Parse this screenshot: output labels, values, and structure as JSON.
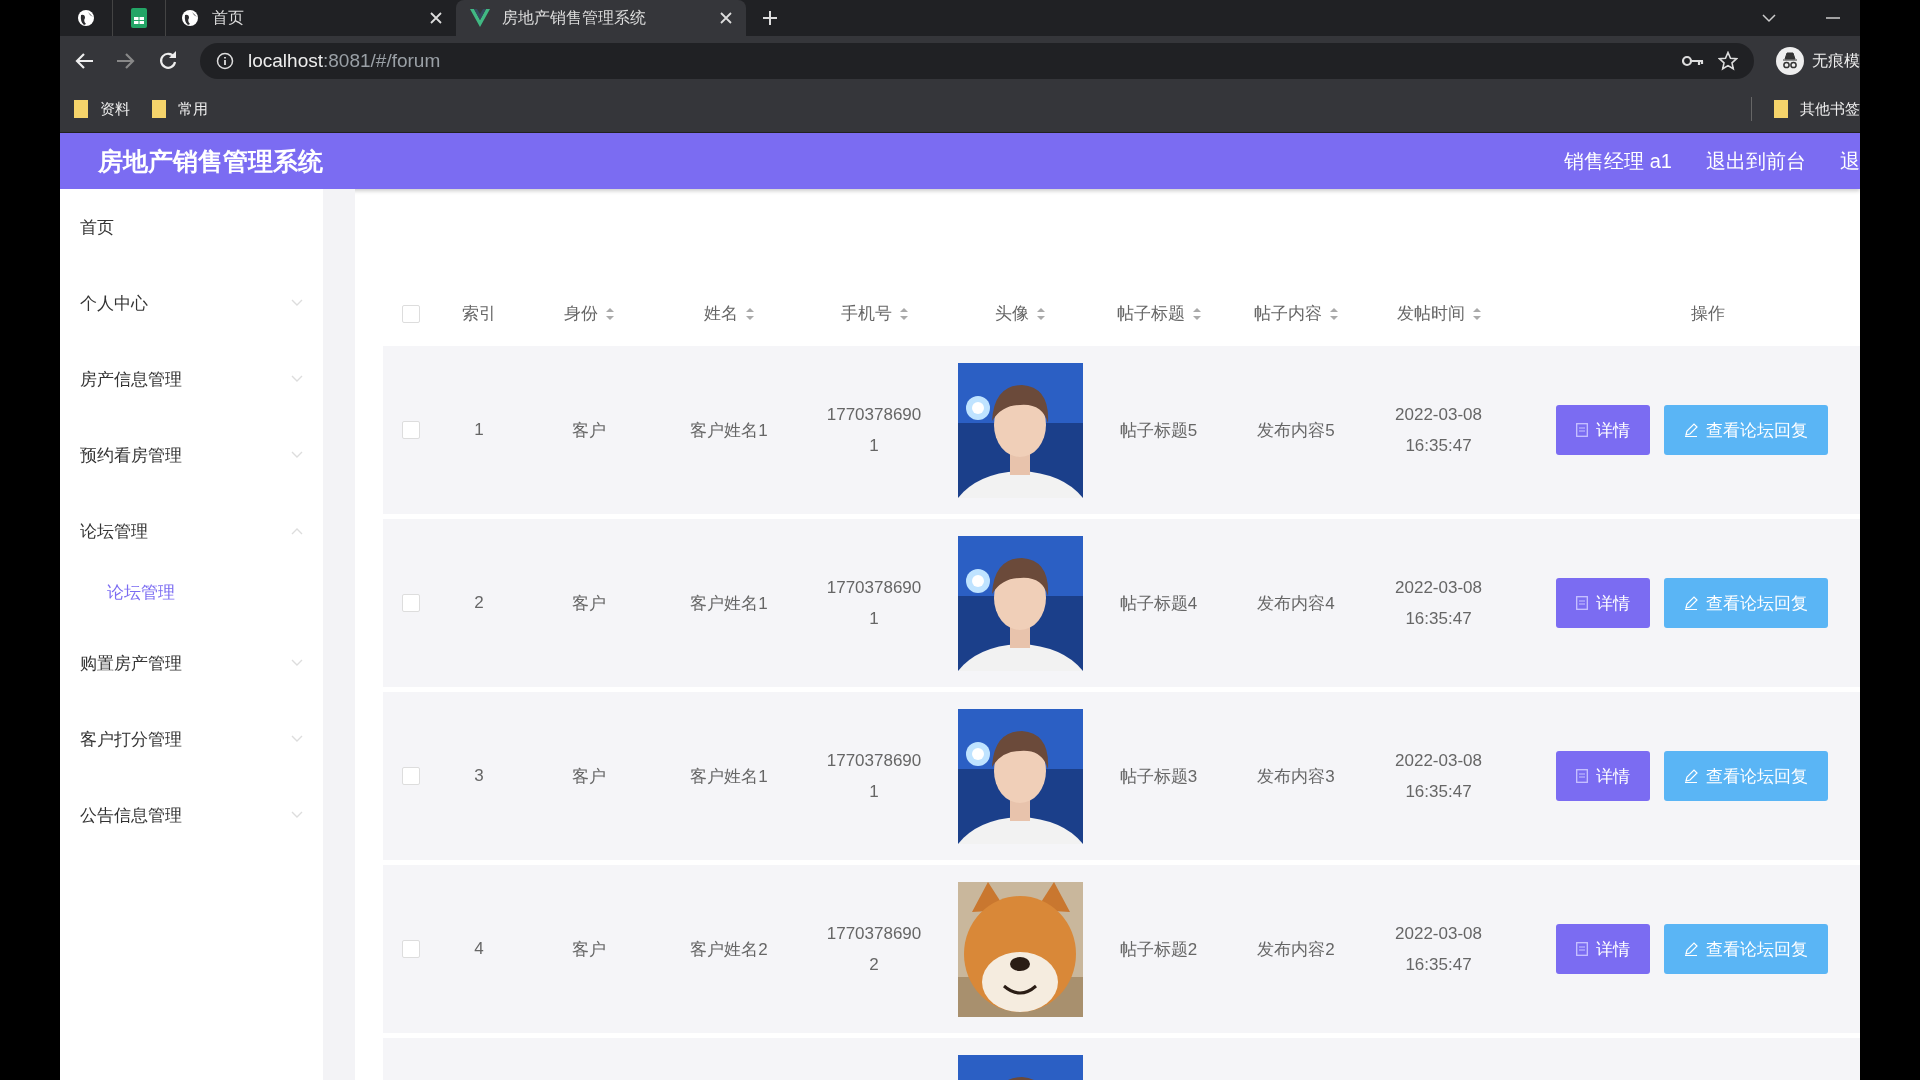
{
  "browser": {
    "tabs": [
      {
        "kind": "pinned-globe",
        "selected": false
      },
      {
        "kind": "pinned-sheet",
        "selected": false
      },
      {
        "kind": "page",
        "title": "首页",
        "selected": false
      },
      {
        "kind": "app",
        "title": "房地产销售管理系统",
        "selected": true
      }
    ],
    "url_host": "localhost",
    "url_rest": ":8081/#/forum",
    "profile_label": "无痕模",
    "bookmarks": [
      "资料",
      "常用"
    ],
    "other_bookmarks": "其他书签"
  },
  "app": {
    "title": "房地产销售管理系统",
    "user": "销售经理 a1",
    "links": [
      "退出到前台",
      "退"
    ]
  },
  "sidebar": [
    {
      "label": "首页",
      "has_arrow": false
    },
    {
      "label": "个人中心",
      "expanded": false,
      "has_arrow": true
    },
    {
      "label": "房产信息管理",
      "expanded": false,
      "has_arrow": true
    },
    {
      "label": "预约看房管理",
      "expanded": false,
      "has_arrow": true
    },
    {
      "label": "论坛管理",
      "expanded": true,
      "has_arrow": true,
      "children": [
        {
          "label": "论坛管理",
          "selected": true
        }
      ]
    },
    {
      "label": "购置房产管理",
      "expanded": false,
      "has_arrow": true
    },
    {
      "label": "客户打分管理",
      "expanded": false,
      "has_arrow": true
    },
    {
      "label": "公告信息管理",
      "expanded": false,
      "has_arrow": true
    }
  ],
  "table": {
    "all_checked": false,
    "columns": [
      {
        "label": "索引",
        "sortable": false
      },
      {
        "label": "身份",
        "sortable": true
      },
      {
        "label": "姓名",
        "sortable": true
      },
      {
        "label": "手机号",
        "sortable": true
      },
      {
        "label": "头像",
        "sortable": true
      },
      {
        "label": "帖子标题",
        "sortable": true
      },
      {
        "label": "帖子内容",
        "sortable": true
      },
      {
        "label": "发帖时间",
        "sortable": true
      },
      {
        "label": "操作",
        "sortable": false
      }
    ],
    "rows": [
      {
        "checked": false,
        "index": "1",
        "role": "客户",
        "name": "客户姓名1",
        "phone": "17703786901",
        "avatar": {
          "kind": "person"
        },
        "title": "帖子标题5",
        "content": "发布内容5",
        "date": "2022-03-08",
        "time": "16:35:47",
        "actions": [
          "详情",
          "查看论坛回复"
        ]
      },
      {
        "checked": false,
        "index": "2",
        "role": "客户",
        "name": "客户姓名1",
        "phone": "17703786901",
        "avatar": {
          "kind": "person"
        },
        "title": "帖子标题4",
        "content": "发布内容4",
        "date": "2022-03-08",
        "time": "16:35:47",
        "actions": [
          "详情",
          "查看论坛回复"
        ]
      },
      {
        "checked": false,
        "index": "3",
        "role": "客户",
        "name": "客户姓名1",
        "phone": "17703786901",
        "avatar": {
          "kind": "person"
        },
        "title": "帖子标题3",
        "content": "发布内容3",
        "date": "2022-03-08",
        "time": "16:35:47",
        "actions": [
          "详情",
          "查看论坛回复"
        ]
      },
      {
        "checked": false,
        "index": "4",
        "role": "客户",
        "name": "客户姓名2",
        "phone": "17703786902",
        "avatar": {
          "kind": "dog"
        },
        "title": "帖子标题2",
        "content": "发布内容2",
        "date": "2022-03-08",
        "time": "16:35:47",
        "actions": [
          "详情",
          "查看论坛回复"
        ]
      },
      {
        "avatar": {
          "kind": "person"
        }
      }
    ]
  }
}
